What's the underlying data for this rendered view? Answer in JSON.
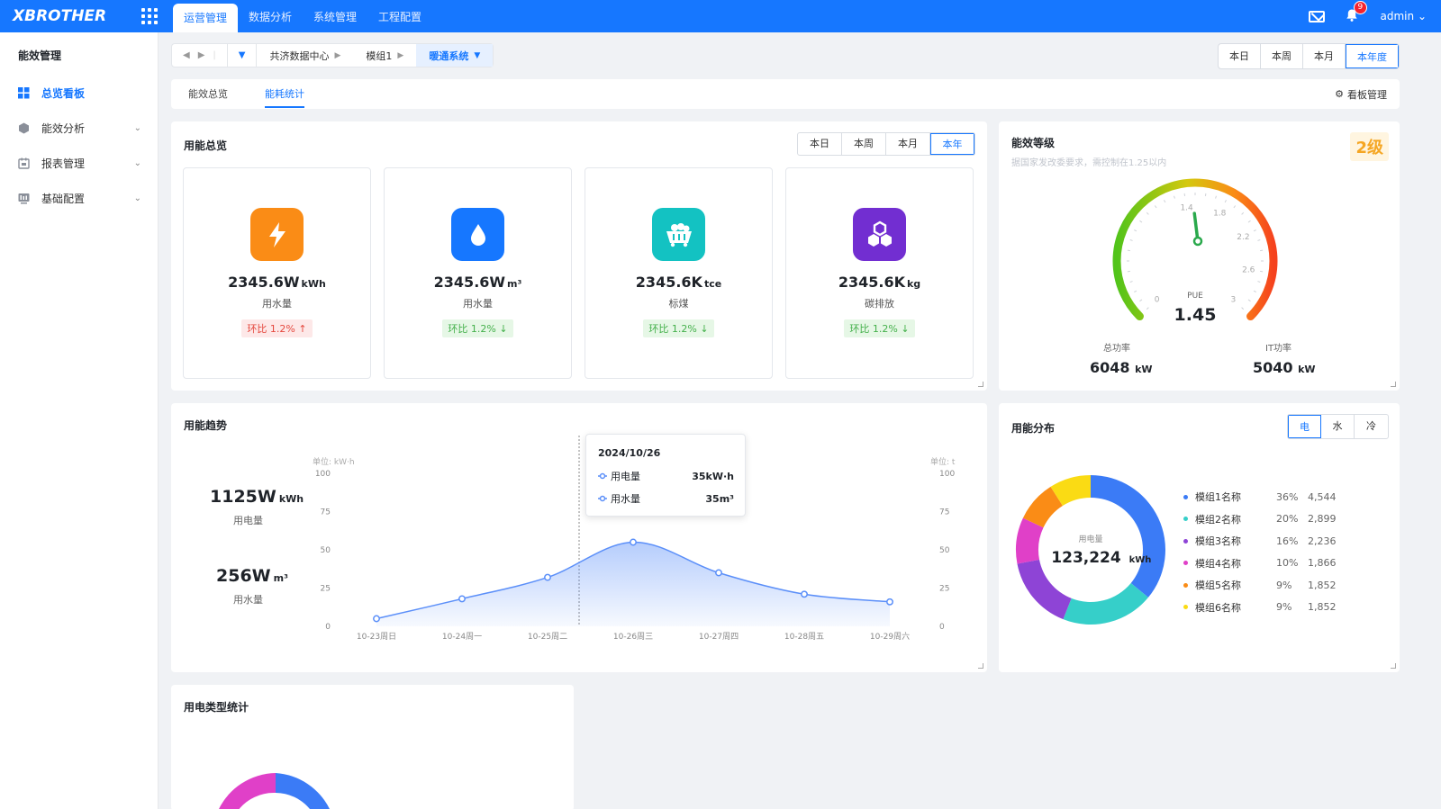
{
  "topbar": {
    "logo": "XBROTHER",
    "tabs": [
      "运营管理",
      "数据分析",
      "系统管理",
      "工程配置"
    ],
    "notification_count": "9",
    "user": "admin"
  },
  "sidebar": {
    "title": "能效管理",
    "items": [
      {
        "label": "总览看板",
        "icon": "dashboard-icon"
      },
      {
        "label": "能效分析",
        "icon": "hexagon-icon"
      },
      {
        "label": "报表管理",
        "icon": "report-icon"
      },
      {
        "label": "基础配置",
        "icon": "config-icon"
      }
    ]
  },
  "breadcrumb": {
    "items": [
      "共济数据中心",
      "模组1",
      "暖通系统"
    ]
  },
  "period": {
    "options": [
      "本日",
      "本周",
      "本月",
      "本年度"
    ],
    "selected": "本年度"
  },
  "subtabs": {
    "items": [
      "能效总览",
      "能耗统计"
    ],
    "active": "能耗统计",
    "board_manage": "看板管理"
  },
  "overview": {
    "title": "用能总览",
    "range_options": [
      "本日",
      "本周",
      "本月",
      "本年"
    ],
    "range_selected": "本年",
    "kpis": [
      {
        "value": "2345.6W",
        "unit": "kWh",
        "label": "用水量",
        "change": "环比 1.2%",
        "trend": "up",
        "color": "#fa8c16",
        "icon": "lightning-icon"
      },
      {
        "value": "2345.6W",
        "unit": "m³",
        "label": "用水量",
        "change": "环比 1.2%",
        "trend": "down",
        "color": "#1677ff",
        "icon": "water-drop-icon"
      },
      {
        "value": "2345.6K",
        "unit": "tce",
        "label": "标煤",
        "change": "环比 1.2%",
        "trend": "down",
        "color": "#13c2c2",
        "icon": "coal-cart-icon"
      },
      {
        "value": "2345.6K",
        "unit": "kg",
        "label": "碳排放",
        "change": "环比 1.2%",
        "trend": "down",
        "color": "#722ed1",
        "icon": "molecule-icon"
      }
    ]
  },
  "efficiency": {
    "title": "能效等级",
    "grade": "2级",
    "note": "据国家发改委要求，需控制在1.25以内",
    "pue_label": "PUE",
    "pue_value": "1.45",
    "gauge_min": 0,
    "gauge_max": 3,
    "gauge_ticks": [
      "0",
      "1.4",
      "1.8",
      "2.2",
      "2.6",
      "3"
    ],
    "total_power_label": "总功率",
    "total_power_value": "6048",
    "it_power_label": "IT功率",
    "it_power_value": "5040",
    "power_unit": "kW"
  },
  "trend": {
    "title": "用能趋势",
    "elec_value": "1125W",
    "elec_unit": "kWh",
    "elec_label": "用电量",
    "water_value": "256W",
    "water_unit": "m³",
    "water_label": "用水量",
    "unit_left": "单位: kW·h",
    "unit_right": "单位: t",
    "tooltip": {
      "date": "2024/10/26",
      "rows": [
        {
          "name": "用电量",
          "value": "35kW·h"
        },
        {
          "name": "用水量",
          "value": "35m³"
        }
      ]
    }
  },
  "chart_data": {
    "type": "area",
    "categories": [
      "10-23周日",
      "10-24周一",
      "10-25周二",
      "10-26周三",
      "10-27周四",
      "10-28周五",
      "10-29周六"
    ],
    "series": [
      {
        "name": "用电量",
        "values": [
          5,
          18,
          32,
          55,
          35,
          21,
          16
        ]
      }
    ],
    "ylim": [
      0,
      100
    ],
    "yticks": [
      "0",
      "25",
      "50",
      "75",
      "100"
    ],
    "grid": false,
    "color": "#5b8ff9"
  },
  "distribution": {
    "title": "用能分布",
    "tabs": [
      "电",
      "水",
      "冷"
    ],
    "active_tab": "电",
    "center_label": "用电量",
    "center_value": "123,224",
    "center_unit": "kWh",
    "items": [
      {
        "name": "模组1名称",
        "pct": "36%",
        "value": "4,544",
        "share": 36,
        "color": "#3b7bf6"
      },
      {
        "name": "模组2名称",
        "pct": "20%",
        "value": "2,899",
        "share": 20,
        "color": "#36cfc9"
      },
      {
        "name": "模组3名称",
        "pct": "16%",
        "value": "2,236",
        "share": 16,
        "color": "#8e44d6"
      },
      {
        "name": "模组4名称",
        "pct": "10%",
        "value": "1,866",
        "share": 10,
        "color": "#e040c8"
      },
      {
        "name": "模组5名称",
        "pct": "9%",
        "value": "1,852",
        "share": 9,
        "color": "#fa8c16"
      },
      {
        "name": "模组6名称",
        "pct": "9%",
        "value": "1,852",
        "share": 9,
        "color": "#fadb14"
      }
    ]
  },
  "elec_type": {
    "title": "用电类型统计"
  }
}
